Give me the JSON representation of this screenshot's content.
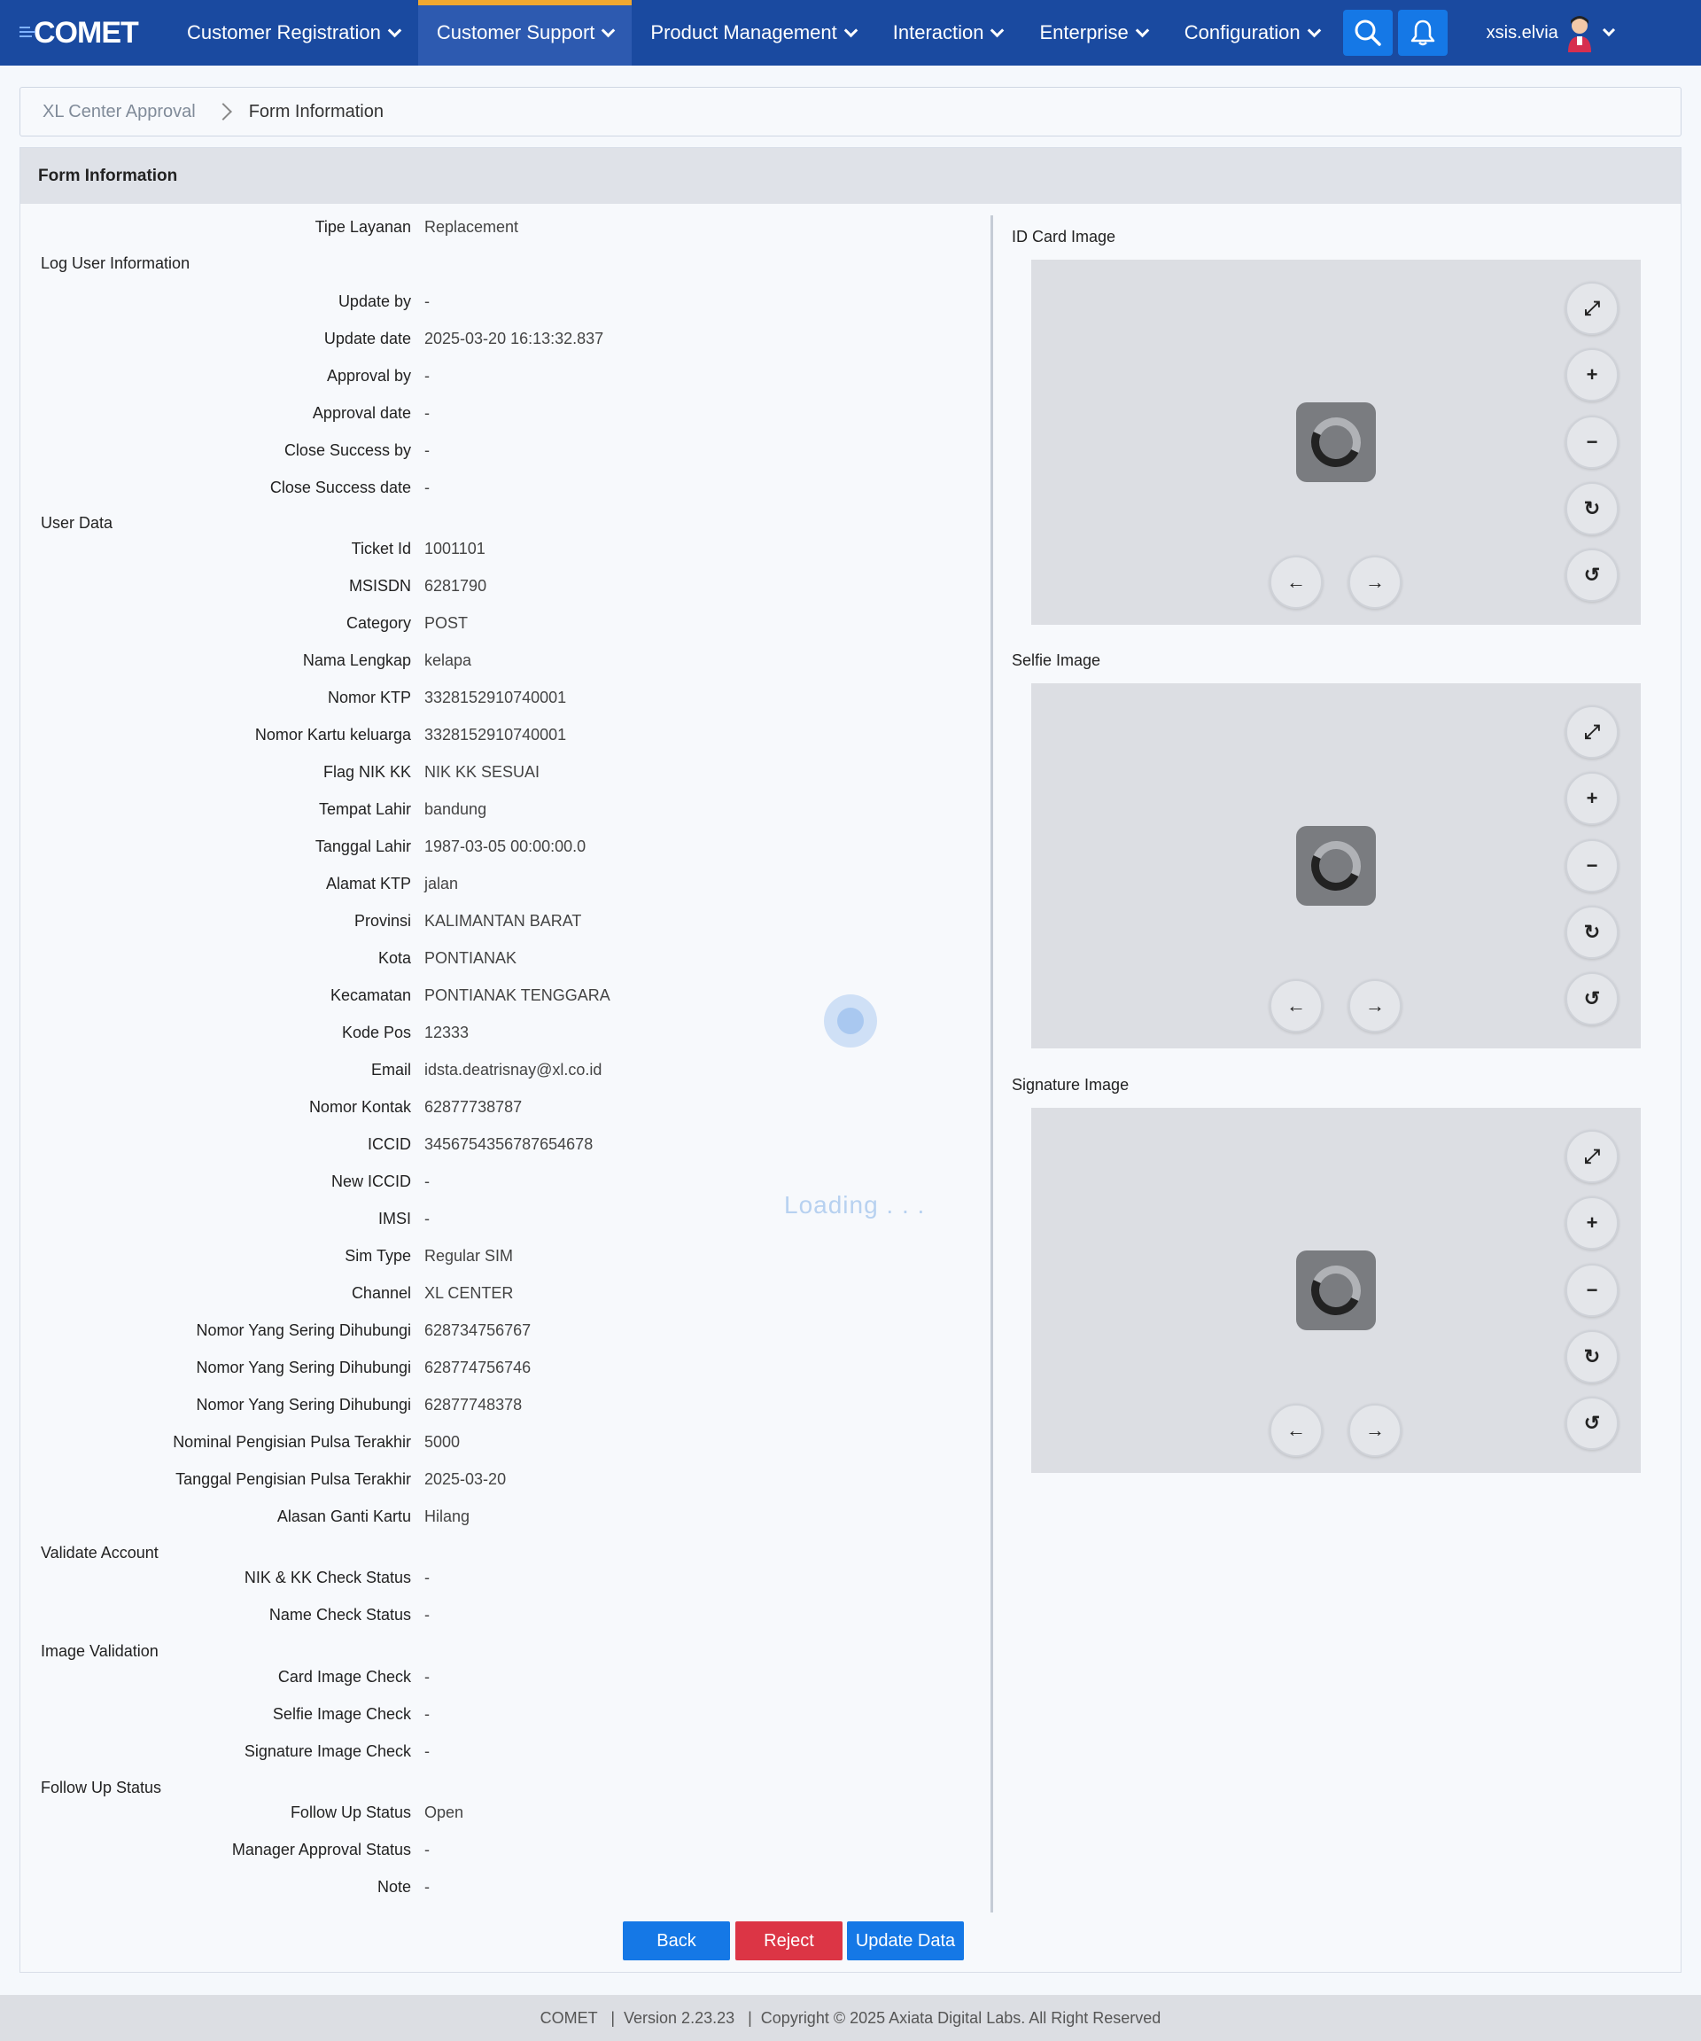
{
  "app": {
    "logo_text": "COMET"
  },
  "nav": {
    "items": [
      {
        "label": "Customer Registration"
      },
      {
        "label": "Customer Support"
      },
      {
        "label": "Product Management"
      },
      {
        "label": "Interaction"
      },
      {
        "label": "Enterprise"
      },
      {
        "label": "Configuration"
      }
    ],
    "active_index": 1,
    "username": "xsis.elvia"
  },
  "breadcrumb": {
    "parent": "XL Center Approval",
    "current": "Form Information"
  },
  "card": {
    "title": "Form Information"
  },
  "form": {
    "tipe_layanan": {
      "label": "Tipe Layanan",
      "value": "Replacement"
    },
    "log_user_title": "Log User Information",
    "log_user": [
      {
        "label": "Update by",
        "value": "-"
      },
      {
        "label": "Update date",
        "value": "2025-03-20 16:13:32.837"
      },
      {
        "label": "Approval by",
        "value": "-"
      },
      {
        "label": "Approval date",
        "value": "-"
      },
      {
        "label": "Close Success by",
        "value": "-"
      },
      {
        "label": "Close Success date",
        "value": "-"
      }
    ],
    "user_data_title": "User Data",
    "user_data": [
      {
        "label": "Ticket Id",
        "value": "1001101"
      },
      {
        "label": "MSISDN",
        "value": "6281790"
      },
      {
        "label": "Category",
        "value": "POST"
      },
      {
        "label": "Nama Lengkap",
        "value": "kelapa"
      },
      {
        "label": "Nomor KTP",
        "value": "3328152910740001"
      },
      {
        "label": "Nomor Kartu keluarga",
        "value": "3328152910740001"
      },
      {
        "label": "Flag NIK KK",
        "value": "NIK KK SESUAI"
      },
      {
        "label": "Tempat Lahir",
        "value": "bandung"
      },
      {
        "label": "Tanggal Lahir",
        "value": "1987-03-05 00:00:00.0"
      },
      {
        "label": "Alamat KTP",
        "value": "jalan"
      },
      {
        "label": "Provinsi",
        "value": "KALIMANTAN BARAT"
      },
      {
        "label": "Kota",
        "value": "PONTIANAK"
      },
      {
        "label": "Kecamatan",
        "value": "PONTIANAK TENGGARA"
      },
      {
        "label": "Kode Pos",
        "value": "12333"
      },
      {
        "label": "Email",
        "value": "idsta.deatrisnay@xl.co.id"
      },
      {
        "label": "Nomor Kontak",
        "value": "62877738787"
      },
      {
        "label": "ICCID",
        "value": "3456754356787654678"
      },
      {
        "label": "New ICCID",
        "value": "-"
      },
      {
        "label": "IMSI",
        "value": "-"
      },
      {
        "label": "Sim Type",
        "value": "Regular SIM"
      },
      {
        "label": "Channel",
        "value": "XL CENTER"
      },
      {
        "label": "Nomor Yang Sering Dihubungi",
        "value": "628734756767"
      },
      {
        "label": "Nomor Yang Sering Dihubungi",
        "value": "628774756746"
      },
      {
        "label": "Nomor Yang Sering Dihubungi",
        "value": "62877748378"
      },
      {
        "label": "Nominal Pengisian Pulsa Terakhir",
        "value": "5000"
      },
      {
        "label": "Tanggal Pengisian Pulsa Terakhir",
        "value": "2025-03-20"
      },
      {
        "label": "Alasan Ganti Kartu",
        "value": "Hilang"
      }
    ],
    "validate_title": "Validate Account",
    "validate": [
      {
        "label": "NIK & KK Check Status",
        "value": "-"
      },
      {
        "label": "Name Check Status",
        "value": "-"
      }
    ],
    "image_validation_title": "Image Validation",
    "image_validation": [
      {
        "label": "Card Image Check",
        "value": "-"
      },
      {
        "label": "Selfie Image Check",
        "value": "-"
      },
      {
        "label": "Signature Image Check",
        "value": "-"
      }
    ],
    "follow_up_title": "Follow Up Status",
    "follow_up": [
      {
        "label": "Follow Up Status",
        "value": "Open"
      },
      {
        "label": "Manager Approval Status",
        "value": "-"
      },
      {
        "label": "Note",
        "value": "-"
      }
    ]
  },
  "images": {
    "id_card_title": "ID Card Image",
    "selfie_title": "Selfie Image",
    "signature_title": "Signature Image"
  },
  "loading_text": "Loading . . .",
  "buttons": {
    "back": "Back",
    "reject": "Reject",
    "update": "Update Data"
  },
  "footer": {
    "text": "COMET   |  Version 2.23.23   |  Copyright © 2025 Axiata Digital Labs. All Right Reserved"
  },
  "colors": {
    "nav_bg": "#1a4aa0",
    "active_accent": "#f0a830",
    "primary": "#1578e6",
    "danger": "#dc3545"
  }
}
